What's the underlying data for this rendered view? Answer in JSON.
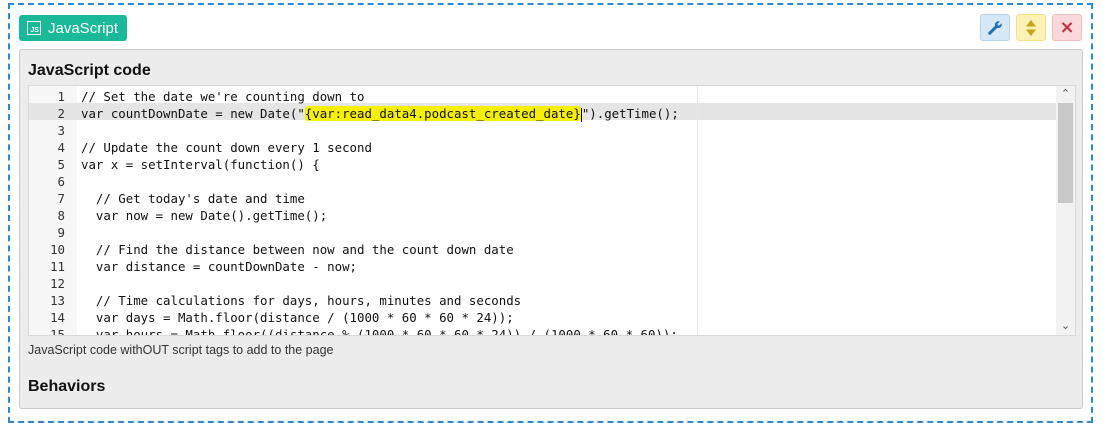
{
  "block": {
    "badge_icon_text": "JS",
    "title": "JavaScript",
    "toolbar": {
      "settings_icon": "wrench-icon",
      "move_icon": "sort-icon",
      "close_icon": "close-icon",
      "close_label": "×"
    },
    "colors": {
      "badge": "#1ab99a",
      "highlight": "#f5f000",
      "frame": "#2a8ad6"
    }
  },
  "code_section": {
    "title": "JavaScript code",
    "help_text": "JavaScript code withOUT script tags to add to the page",
    "lines": [
      {
        "num": "1",
        "text": "// Set the date we're counting down to"
      },
      {
        "num": "2",
        "before": "var countDownDate = new Date(\"",
        "highlight": "{var:read_data4.podcast_created_date}",
        "after": "\").getTime();"
      },
      {
        "num": "3",
        "text": ""
      },
      {
        "num": "4",
        "text": "// Update the count down every 1 second"
      },
      {
        "num": "5",
        "text": "var x = setInterval(function() {"
      },
      {
        "num": "6",
        "text": ""
      },
      {
        "num": "7",
        "text": "  // Get today's date and time"
      },
      {
        "num": "8",
        "text": "  var now = new Date().getTime();"
      },
      {
        "num": "9",
        "text": ""
      },
      {
        "num": "10",
        "text": "  // Find the distance between now and the count down date"
      },
      {
        "num": "11",
        "text": "  var distance = countDownDate - now;"
      },
      {
        "num": "12",
        "text": ""
      },
      {
        "num": "13",
        "text": "  // Time calculations for days, hours, minutes and seconds"
      },
      {
        "num": "14",
        "text": "  var days = Math.floor(distance / (1000 * 60 * 60 * 24));"
      },
      {
        "num": "15",
        "text": "  var hours = Math.floor((distance % (1000 * 60 * 60 * 24)) / (1000 * 60 * 60));"
      }
    ],
    "scroll_up_icon": "chevron-up-icon",
    "scroll_down_icon": "chevron-down-icon"
  },
  "behaviors_section": {
    "title": "Behaviors"
  }
}
